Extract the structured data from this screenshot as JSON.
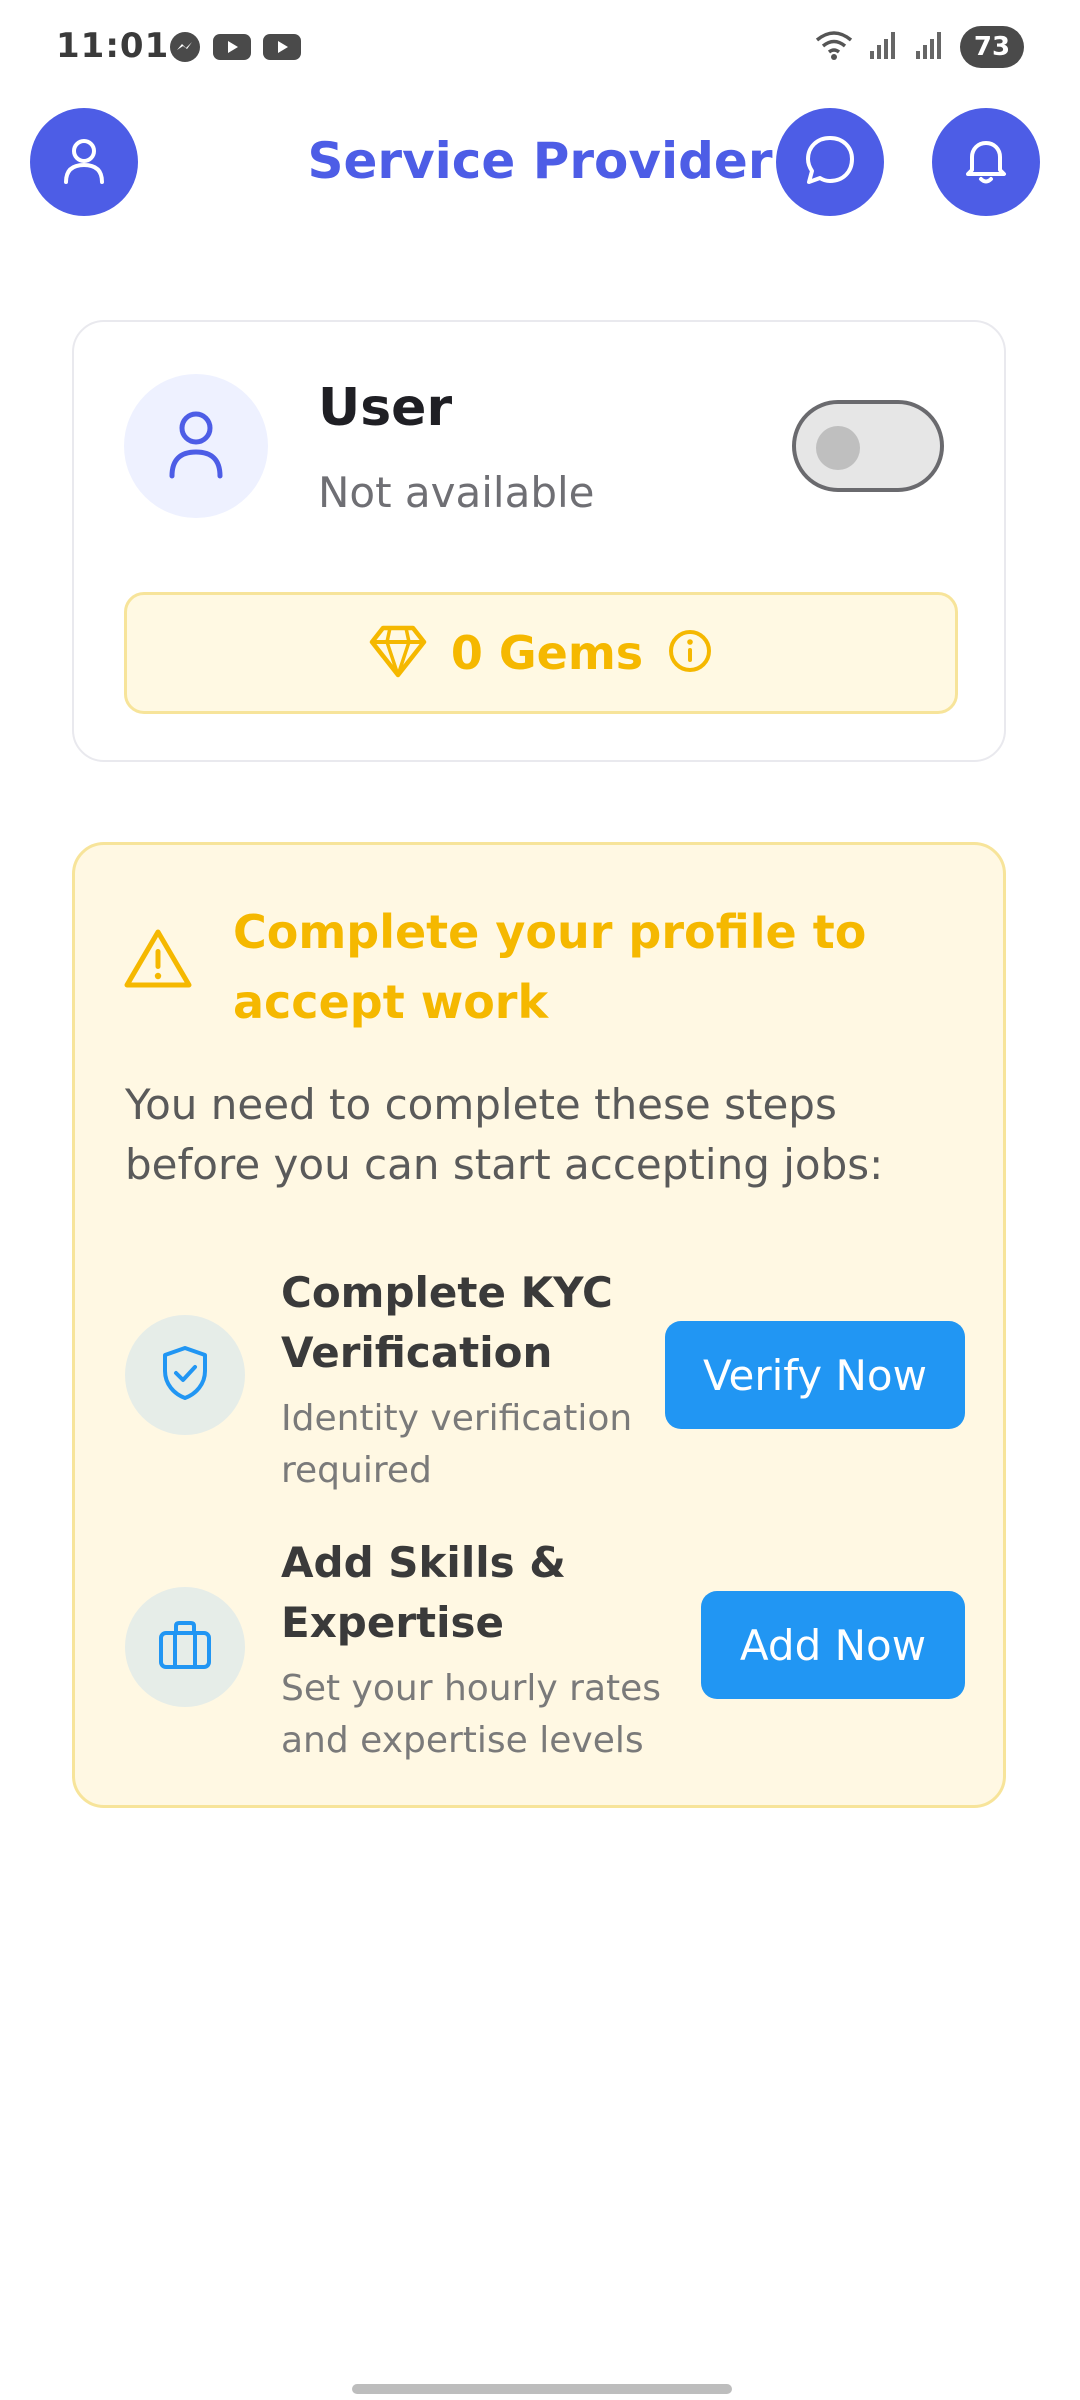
{
  "status_bar": {
    "time": "11:01",
    "battery": "73",
    "left_icons": [
      "messenger-icon",
      "youtube-icon",
      "youtube-icon"
    ],
    "right_icons": [
      "wifi-icon",
      "signal-icon",
      "signal-icon",
      "battery-icon"
    ]
  },
  "header": {
    "title": "Service Provider",
    "left_icon": "profile-icon",
    "chat_icon": "chat-icon",
    "notification_icon": "bell-icon",
    "accent_color": "#4d5de6"
  },
  "user_card": {
    "name": "User",
    "status": "Not available",
    "availability_toggle_on": false,
    "gems_label": "0 Gems"
  },
  "profile_warning": {
    "title": "Complete your profile to accept work",
    "description": "You need to complete these steps before you can start accepting jobs:",
    "accent_color": "#f5b800",
    "steps": [
      {
        "title": "Complete KYC Verification",
        "subtitle": "Identity verification required",
        "button_label": "Verify Now",
        "icon": "shield-check-icon"
      },
      {
        "title": "Add Skills & Expertise",
        "subtitle": "Set your hourly rates and expertise levels",
        "button_label": "Add Now",
        "icon": "briefcase-icon"
      }
    ],
    "button_color": "#2196f3"
  }
}
